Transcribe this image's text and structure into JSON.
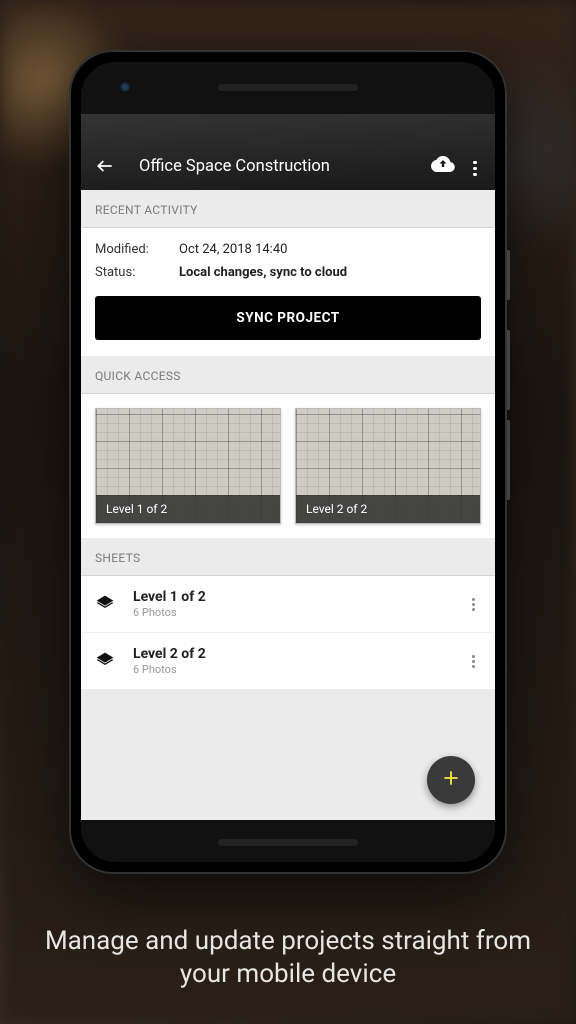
{
  "appbar": {
    "title": "Office Space Construction"
  },
  "recent": {
    "header": "RECENT ACTIVITY",
    "modified_label": "Modified:",
    "modified_value": "Oct 24, 2018 14:40",
    "status_label": "Status:",
    "status_value": "Local changes, sync to cloud",
    "sync_button": "SYNC PROJECT"
  },
  "quick": {
    "header": "QUICK ACCESS",
    "tiles": [
      {
        "label": "Level 1 of 2"
      },
      {
        "label": "Level 2 of 2"
      }
    ]
  },
  "sheets": {
    "header": "SHEETS",
    "items": [
      {
        "title": "Level 1 of 2",
        "subtitle": "6 Photos"
      },
      {
        "title": "Level 2 of 2",
        "subtitle": "6 Photos"
      }
    ]
  },
  "tagline": "Manage and update projects straight from your mobile device"
}
